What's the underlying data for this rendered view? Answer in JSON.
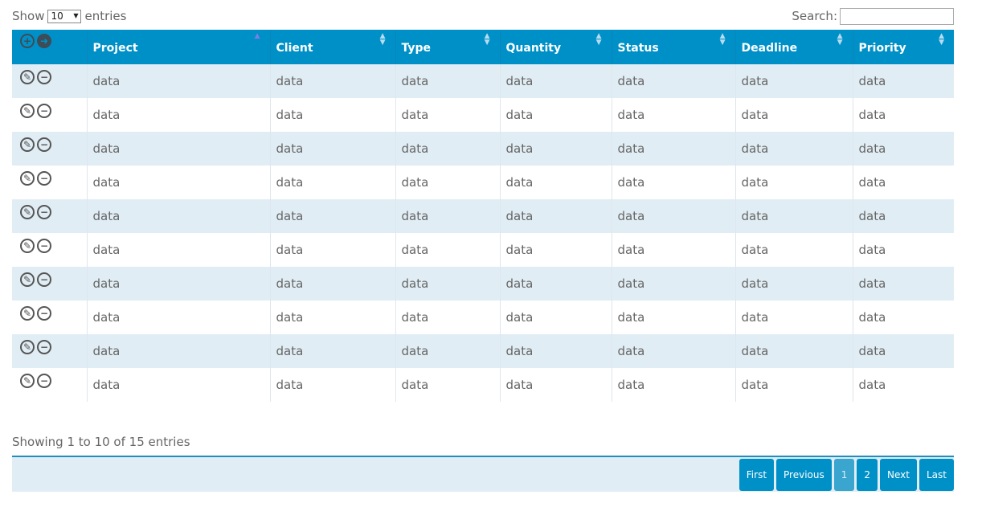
{
  "length": {
    "show_label": "Show",
    "selected": "10",
    "entries_label": "entries"
  },
  "search": {
    "label": "Search:",
    "value": "",
    "placeholder": ""
  },
  "columns": [
    {
      "label": "Project",
      "sort": "asc"
    },
    {
      "label": "Client",
      "sort": "both"
    },
    {
      "label": "Type",
      "sort": "both"
    },
    {
      "label": "Quantity",
      "sort": "both"
    },
    {
      "label": "Status",
      "sort": "both"
    },
    {
      "label": "Deadline",
      "sort": "both"
    },
    {
      "label": "Priority",
      "sort": "both"
    }
  ],
  "header_icons": [
    "add-circle-icon",
    "arrow-circle-icon"
  ],
  "row_icons": [
    "edit-circle-icon",
    "remove-circle-icon"
  ],
  "rows": [
    [
      "data",
      "data",
      "data",
      "data",
      "data",
      "data",
      "data"
    ],
    [
      "data",
      "data",
      "data",
      "data",
      "data",
      "data",
      "data"
    ],
    [
      "data",
      "data",
      "data",
      "data",
      "data",
      "data",
      "data"
    ],
    [
      "data",
      "data",
      "data",
      "data",
      "data",
      "data",
      "data"
    ],
    [
      "data",
      "data",
      "data",
      "data",
      "data",
      "data",
      "data"
    ],
    [
      "data",
      "data",
      "data",
      "data",
      "data",
      "data",
      "data"
    ],
    [
      "data",
      "data",
      "data",
      "data",
      "data",
      "data",
      "data"
    ],
    [
      "data",
      "data",
      "data",
      "data",
      "data",
      "data",
      "data"
    ],
    [
      "data",
      "data",
      "data",
      "data",
      "data",
      "data",
      "data"
    ],
    [
      "data",
      "data",
      "data",
      "data",
      "data",
      "data",
      "data"
    ]
  ],
  "info": "Showing 1 to 10 of 15 entries",
  "pagination": [
    {
      "label": "First",
      "current": false
    },
    {
      "label": "Previous",
      "current": false
    },
    {
      "label": "1",
      "current": true
    },
    {
      "label": "2",
      "current": false
    },
    {
      "label": "Next",
      "current": false
    },
    {
      "label": "Last",
      "current": false
    }
  ]
}
